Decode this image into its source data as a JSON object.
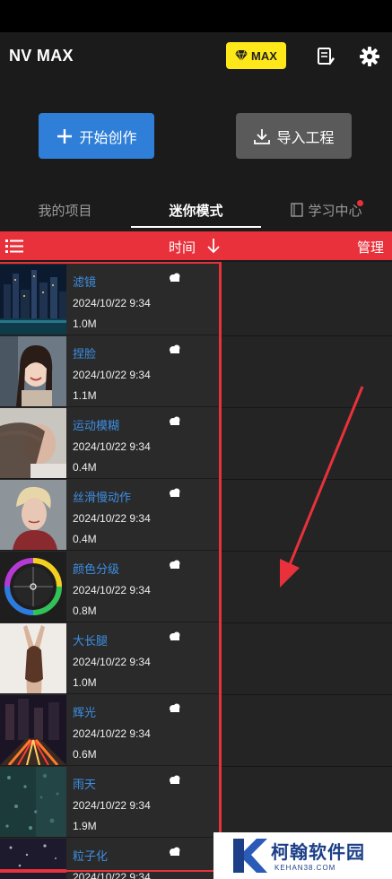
{
  "header": {
    "app_title": "NV MAX",
    "max_badge": "MAX",
    "colors": {
      "badge": "#ffe81a",
      "accent": "#e8313b",
      "create": "#2f7fd9"
    }
  },
  "actions": {
    "create_label": "开始创作",
    "import_label": "导入工程"
  },
  "tabs": [
    {
      "label": "我的项目",
      "active": false
    },
    {
      "label": "迷你模式",
      "active": true
    },
    {
      "label": "学习中心",
      "active": false,
      "has_dot": true
    }
  ],
  "toolbar": {
    "sort_label": "时间",
    "manage_label": "管理"
  },
  "projects": [
    {
      "name": "滤镜",
      "date": "2024/10/22 9:34",
      "size": "1.0M",
      "thumb": "city-night"
    },
    {
      "name": "捏脸",
      "date": "2024/10/22 9:34",
      "size": "1.1M",
      "thumb": "portrait-smile"
    },
    {
      "name": "运动模糊",
      "date": "2024/10/22 9:34",
      "size": "0.4M",
      "thumb": "motion-blur-portrait"
    },
    {
      "name": "丝滑慢动作",
      "date": "2024/10/22 9:34",
      "size": "0.4M",
      "thumb": "portrait-blonde"
    },
    {
      "name": "颜色分级",
      "date": "2024/10/22 9:34",
      "size": "0.8M",
      "thumb": "color-wheel"
    },
    {
      "name": "大长腿",
      "date": "2024/10/22 9:34",
      "size": "1.0M",
      "thumb": "dancer"
    },
    {
      "name": "辉光",
      "date": "2024/10/22 9:34",
      "size": "0.6M",
      "thumb": "city-lights"
    },
    {
      "name": "雨天",
      "date": "2024/10/22 9:34",
      "size": "1.9M",
      "thumb": "rain-window"
    },
    {
      "name": "粒子化",
      "date": "2024/10/22 9:34",
      "size": "",
      "thumb": "particles"
    }
  ],
  "watermark": {
    "name": "柯翰软件园",
    "url": "KEHAN38.COM"
  }
}
